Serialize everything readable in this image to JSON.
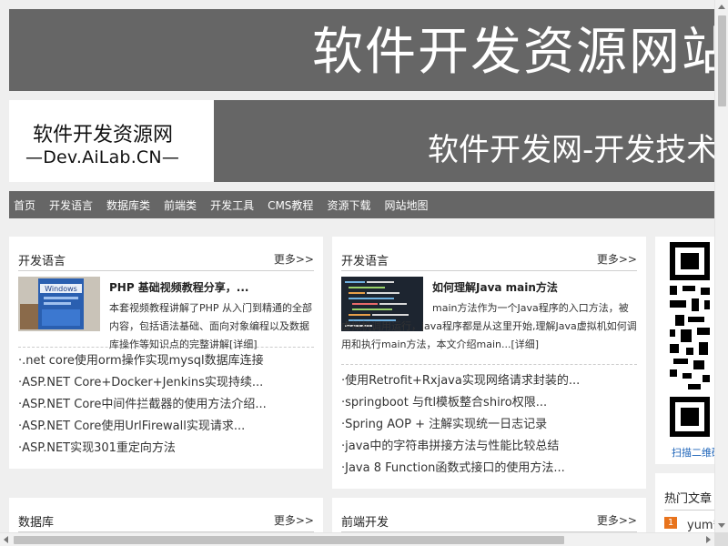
{
  "header": {
    "banner_text": "软件开发资源网站标题",
    "logo_line1": "软件开发资源网",
    "logo_line2": "—Dev.AiLab.CN—",
    "banner2_text": "软件开发网-开发技术资源分享"
  },
  "nav": {
    "items": [
      "首页",
      "开发语言",
      "数据库类",
      "前端类",
      "开发工具",
      "CMS教程",
      "资源下载",
      "网站地图"
    ]
  },
  "panels": {
    "p1": {
      "title": "开发语言",
      "more": "更多>>",
      "feature_title": "PHP 基础视频教程分享，...",
      "feature_desc": "本套视频教程讲解了PHP 从入门到精通的全部内容，包括语法基础、面向对象编程以及数据库操作等知识点的完整讲解",
      "feature_more": "[详细]",
      "list": [
        "·.net core使用orm操作实现mysql数据库连接",
        "·ASP.NET Core+Docker+Jenkins实现持续...",
        "·ASP.NET Core中间件拦截器的使用方法介绍...",
        "·ASP.NET Core使用UrlFirewall实现请求...",
        "·ASP.NET实现301重定向方法"
      ]
    },
    "p2": {
      "title": "开发语言",
      "more": "更多>>",
      "feature_title": "如何理解Java main方法",
      "feature_desc": "main方法作为一个Java程序的入口方法，被虚拟机调用运行，java程序都是从这里开始,理解Java虚拟机如何调用和执行main方法，本文介绍main...",
      "feature_more": "[详细]",
      "list": [
        "·使用Retrofit+Rxjava实现网络请求封装的...",
        "·springboot 与ftl模板整合shiro权限...",
        "·Spring AOP + 注解实现统一日志记录",
        "·java中的字符串拼接方法与性能比较总结",
        "·Java 8 Function函数式接口的使用方法..."
      ]
    },
    "p3": {
      "title": "数据库",
      "more": "更多>>"
    },
    "p4": {
      "title": "前端开发",
      "more": "更多>>"
    }
  },
  "sidebar": {
    "qr_caption": "扫描二维码关注我们",
    "hot_title": "热门文章",
    "hot_items": [
      {
        "rank": "1",
        "text": "yum安装"
      }
    ]
  }
}
